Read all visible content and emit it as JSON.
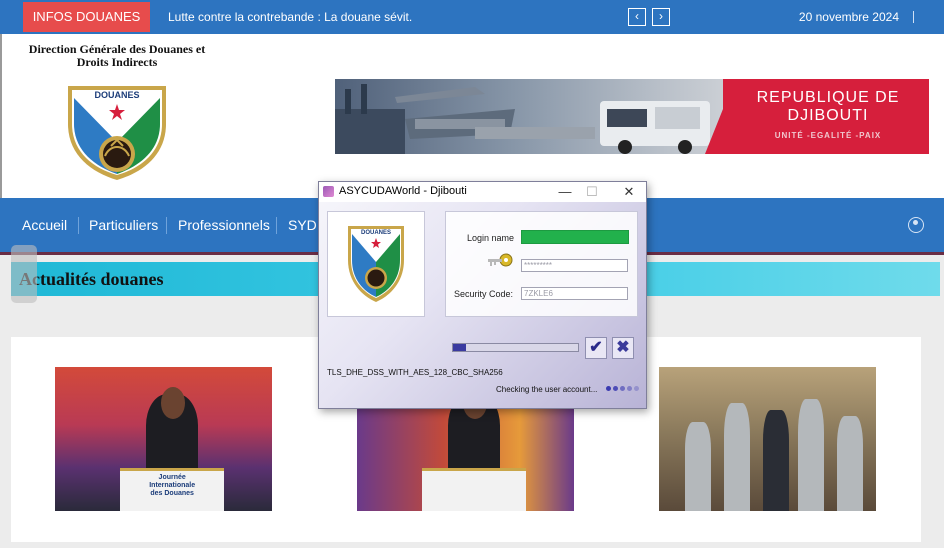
{
  "topbar": {
    "badge": "INFOS DOUANES",
    "ticker": "Lutte contre la contrebande : La douane sévit.",
    "prev": "‹",
    "next": "›",
    "date": "20 novembre 2024"
  },
  "header": {
    "org_line1": "Direction Générale des Douanes et",
    "org_line2": "Droits Indirects",
    "logo_text": "DOUANES",
    "banner_title": "REPUBLIQUE DE DJIBOUTI",
    "banner_motto": "UNITÉ -EGALITÉ -PAIX"
  },
  "nav": {
    "items": [
      {
        "label": "Accueil"
      },
      {
        "label": "Particuliers"
      },
      {
        "label": "Professionnels"
      },
      {
        "label": "SYD"
      }
    ]
  },
  "news": {
    "heading": "Actualités douanes"
  },
  "photos": {
    "podium_line1": "Journée",
    "podium_line2": "Internationale",
    "podium_line3": "des Douanes"
  },
  "dialog": {
    "title": "ASYCUDAWorld - Djibouti",
    "minimize": "—",
    "maximize": "☐",
    "close": "✕",
    "logo_text": "DOUANES",
    "login_label": "Login name",
    "login_value": "",
    "password_value": "*********",
    "security_label": "Security Code:",
    "security_value": "7ZKLE6",
    "progress": 0.1,
    "ok": "✔",
    "cancel": "✖",
    "tls": "TLS_DHE_DSS_WITH_AES_128_CBC_SHA256",
    "status": "Checking the user account..."
  },
  "colors": {
    "primary_blue": "#2d74c0",
    "badge_red": "#e74c4c",
    "heading_cyan": "#1fb8d6",
    "login_green": "#22b14c"
  }
}
